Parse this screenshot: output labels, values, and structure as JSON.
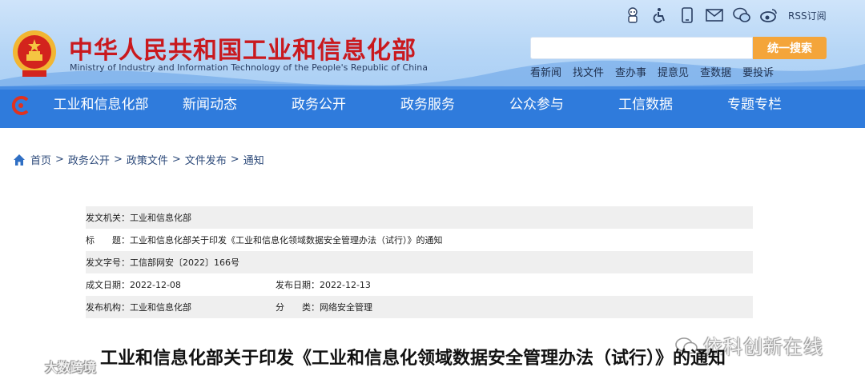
{
  "header": {
    "site_title": "中华人民共和国工业和信息化部",
    "site_subtitle": "Ministry of Industry and Information Technology of the People's Republic of China",
    "rss_label": "RSS订阅",
    "search_button": "统一搜索",
    "search_placeholder": "",
    "quick_links": [
      "看新闻",
      "找文件",
      "查办事",
      "提意见",
      "查数据",
      "要投诉"
    ],
    "accent_color": "#c9191e",
    "search_button_color": "#f4a53a"
  },
  "nav": {
    "items": [
      "工业和信息化部",
      "新闻动态",
      "政务公开",
      "政务服务",
      "公众参与",
      "工信数据",
      "专题专栏"
    ]
  },
  "breadcrumb": {
    "items": [
      "首页",
      "政务公开",
      "政策文件",
      "文件发布",
      "通知"
    ],
    "separator": ">"
  },
  "meta": {
    "issuer_label": "发文机关：",
    "issuer_value": "工业和信息化部",
    "title_label": "标　　题：",
    "title_value": "工业和信息化部关于印发《工业和信息化领域数据安全管理办法（试行）》的通知",
    "doc_no_label": "发文字号：",
    "doc_no_value": "工信部网安〔2022〕166号",
    "created_label": "成文日期：",
    "created_value": "2022-12-08",
    "published_label": "发布日期：",
    "published_value": "2022-12-13",
    "org_label": "发布机构：",
    "org_value": "工业和信息化部",
    "category_label": "分　　类：",
    "category_value": "网络安全管理"
  },
  "document": {
    "heading": "工业和信息化部关于印发《工业和信息化领域数据安全管理办法（试行）》的通知"
  },
  "watermarks": {
    "right": "依科创新在线",
    "left": "大数跨境"
  }
}
